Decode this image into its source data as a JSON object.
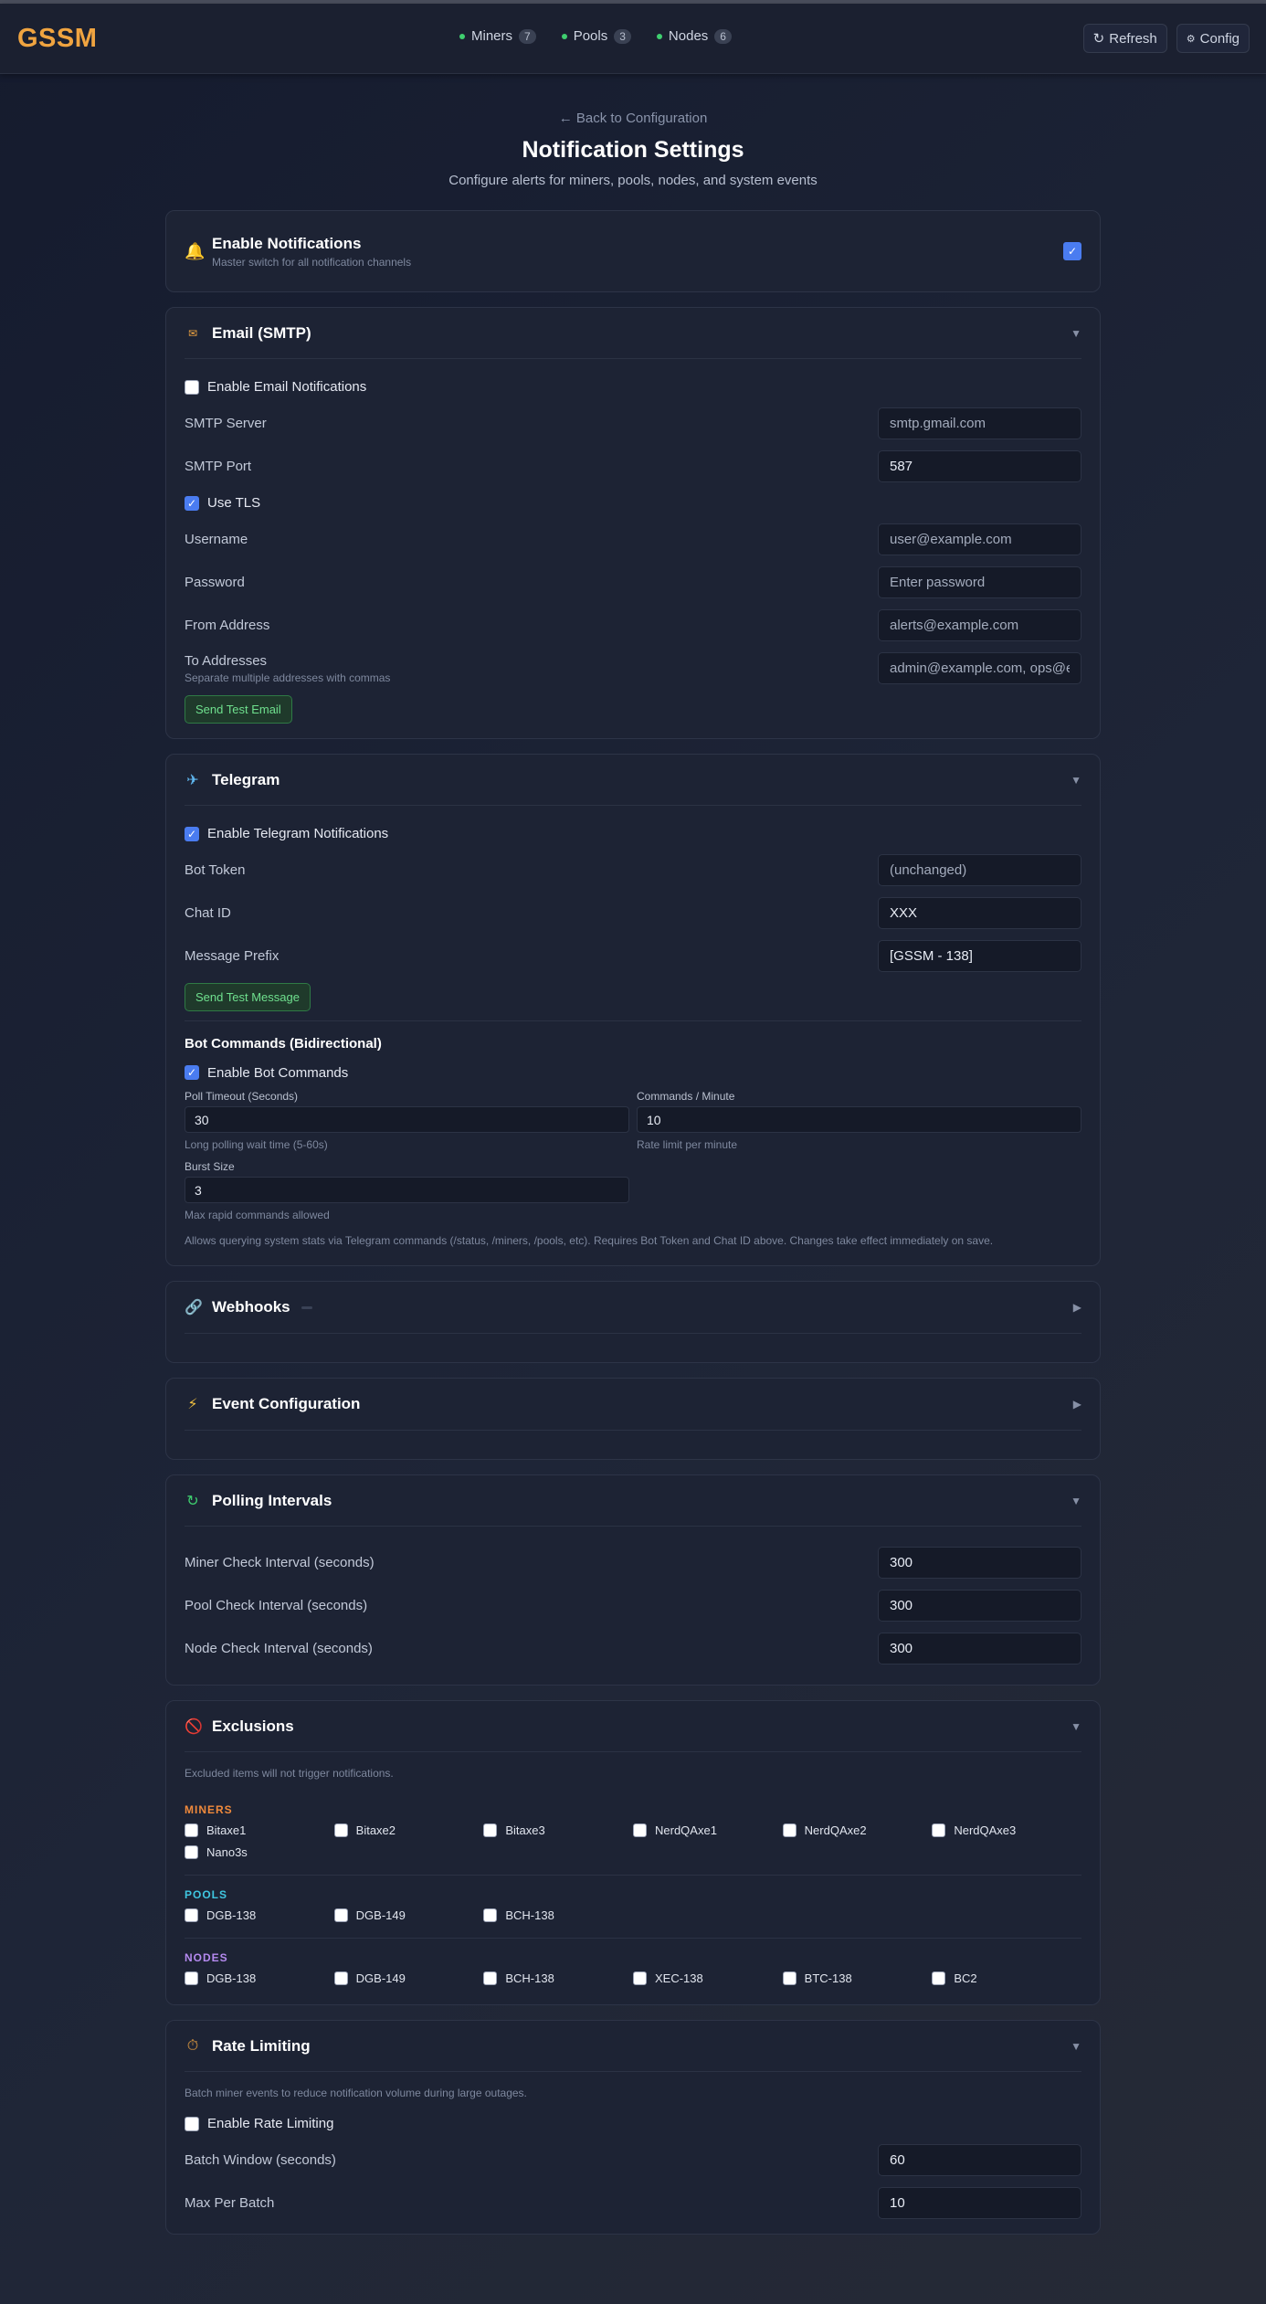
{
  "app": {
    "logo": "GSSM"
  },
  "nav": {
    "tabs": [
      {
        "label": "Miners",
        "count": "7"
      },
      {
        "label": "Pools",
        "count": "3"
      },
      {
        "label": "Nodes",
        "count": "6"
      }
    ],
    "refresh_label": "Refresh",
    "config_label": "Config"
  },
  "header": {
    "back_link": "← Back to Configuration",
    "title": "Notification Settings",
    "subtitle": "Configure alerts for miners, pools, nodes, and system events"
  },
  "master": {
    "title": "Enable Notifications",
    "description": "Master switch for all notification channels",
    "enabled": true
  },
  "email": {
    "title": "Email (SMTP)",
    "enable_label": "Enable Email Notifications",
    "smtp_server_label": "SMTP Server",
    "smtp_server_placeholder": "smtp.gmail.com",
    "smtp_port_label": "SMTP Port",
    "smtp_port_value": "587",
    "tls_label": "Use TLS",
    "username_label": "Username",
    "username_placeholder": "user@example.com",
    "password_label": "Password",
    "password_placeholder": "Enter password",
    "from_label": "From Address",
    "from_placeholder": "alerts@example.com",
    "to_label": "To Addresses",
    "to_help": "Separate multiple addresses with commas",
    "to_placeholder": "admin@example.com, ops@example.com",
    "test_button": "Send Test Email"
  },
  "telegram": {
    "title": "Telegram",
    "enable_label": "Enable Telegram Notifications",
    "bot_token_label": "Bot Token",
    "bot_token_placeholder": "(unchanged)",
    "chat_id_label": "Chat ID",
    "chat_id_value": "XXX",
    "prefix_label": "Message Prefix",
    "prefix_value": "[GSSM - 138]",
    "test_button": "Send Test Message",
    "bot_commands_title": "Bot Commands (Bidirectional)",
    "bot_commands_enable_label": "Enable Bot Commands",
    "poll_timeout_label": "Poll Timeout (Seconds)",
    "poll_timeout_value": "30",
    "poll_timeout_help": "Long polling wait time (5-60s)",
    "commands_per_minute_label": "Commands / Minute",
    "commands_per_minute_value": "10",
    "commands_per_minute_help": "Rate limit per minute",
    "burst_label": "Burst Size",
    "burst_value": "3",
    "burst_help": "Max rapid commands allowed",
    "note": "Allows querying system stats via Telegram commands (/status, /miners, /pools, etc). Requires Bot Token and Chat ID above. Changes take effect immediately on save."
  },
  "webhooks": {
    "title": "Webhooks"
  },
  "events": {
    "title": "Event Configuration"
  },
  "polling": {
    "title": "Polling Intervals",
    "miner_label": "Miner Check Interval (seconds)",
    "miner_value": "300",
    "pool_label": "Pool Check Interval (seconds)",
    "pool_value": "300",
    "node_label": "Node Check Interval (seconds)",
    "node_value": "300"
  },
  "exclusions": {
    "title": "Exclusions",
    "description": "Excluded items will not trigger notifications.",
    "miners_label": "MINERS",
    "miners": [
      "Bitaxe1",
      "Bitaxe2",
      "Bitaxe3",
      "NerdQAxe1",
      "NerdQAxe2",
      "NerdQAxe3",
      "Nano3s"
    ],
    "pools_label": "POOLS",
    "pools": [
      "DGB-138",
      "DGB-149",
      "BCH-138"
    ],
    "nodes_label": "NODES",
    "nodes": [
      "DGB-138",
      "DGB-149",
      "BCH-138",
      "XEC-138",
      "BTC-138",
      "BC2"
    ]
  },
  "rate_limiting": {
    "title": "Rate Limiting",
    "description": "Batch miner events to reduce notification volume during large outages.",
    "enable_label": "Enable Rate Limiting",
    "batch_window_label": "Batch Window (seconds)",
    "batch_window_value": "60",
    "max_per_batch_label": "Max Per Batch",
    "max_per_batch_value": "10"
  },
  "colors": {
    "accent": "#f0a440",
    "miners_label": "#f08a3c",
    "pools_label": "#3fc6e0",
    "nodes_label": "#b58af0",
    "success": "#6fe08e"
  }
}
